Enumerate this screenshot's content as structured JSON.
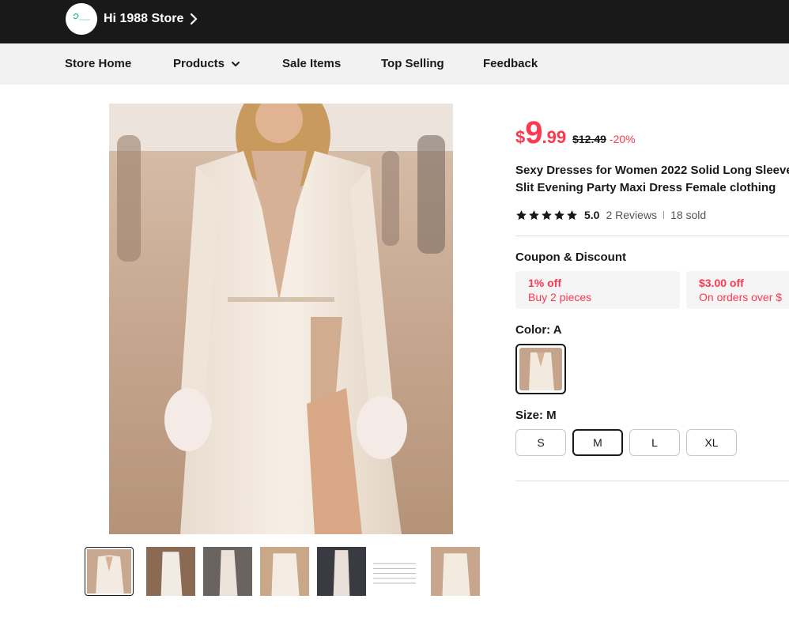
{
  "store": {
    "name": "Hi 1988 Store"
  },
  "nav": {
    "items": [
      {
        "label": "Store Home"
      },
      {
        "label": "Products"
      },
      {
        "label": "Sale Items"
      },
      {
        "label": "Top Selling"
      },
      {
        "label": "Feedback"
      }
    ]
  },
  "product": {
    "price": {
      "currency": "$",
      "integer": "9",
      "decimal": ".99",
      "original": "$12.49",
      "discount": "-20%"
    },
    "title_lines": [
      "Sexy Dresses for Women 2022 Solid Long Sleeve",
      "Slit Evening Party Maxi Dress Female clothing"
    ],
    "rating": {
      "stars": 5,
      "value": "5.0",
      "reviews": "2 Reviews",
      "sold": "18 sold"
    },
    "coupons": {
      "label": "Coupon & Discount",
      "items": [
        {
          "title": "1% off",
          "desc": "Buy 2 pieces"
        },
        {
          "title": "$3.00 off",
          "desc": "On orders over $"
        }
      ]
    },
    "color": {
      "label": "Color: A"
    },
    "size": {
      "label": "Size: M",
      "options": [
        "S",
        "M",
        "L",
        "XL"
      ],
      "selected": "M"
    },
    "thumbnails": 7
  },
  "colors": {
    "accent": "#fd384f",
    "store_bar": "#191919",
    "nav_bg": "#f2f2f2",
    "coupon_bg": "#f5f5f5"
  }
}
